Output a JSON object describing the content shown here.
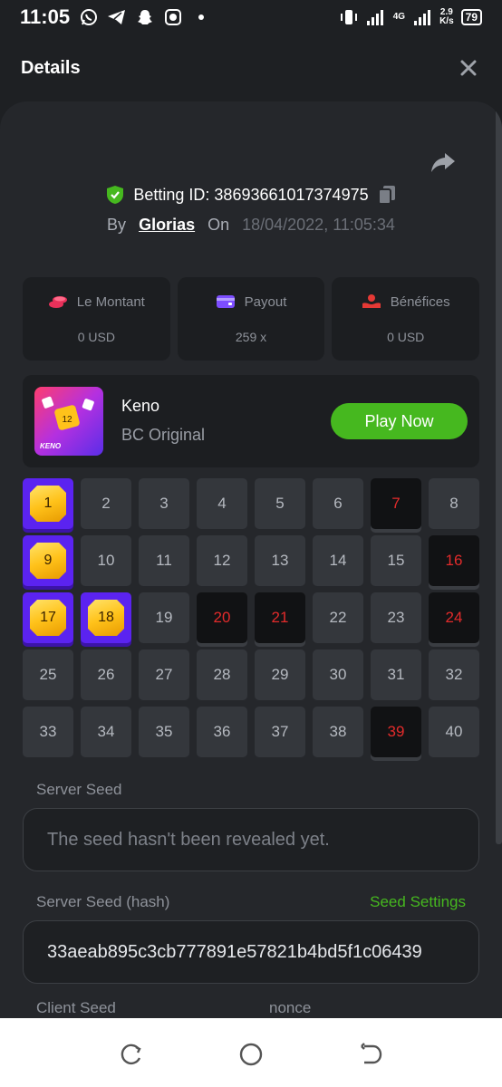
{
  "status_bar": {
    "time": "11:05",
    "network_type": "4G",
    "speed_value": "2.9",
    "speed_unit": "K/s",
    "battery": "79",
    "app_icons": [
      "whatsapp-icon",
      "telegram-icon",
      "snapchat-icon",
      "bitcoin-icon",
      "dot-icon"
    ]
  },
  "header": {
    "title": "Details"
  },
  "bet": {
    "id_label": "Betting ID: 38693661017374975",
    "by_label": "By",
    "username": "Glorias",
    "on_label": "On",
    "date": "18/04/2022, 11:05:34"
  },
  "stats": [
    {
      "label": "Le Montant",
      "value": "0 USD",
      "icon": "coins-icon",
      "color": "#e8315a"
    },
    {
      "label": "Payout",
      "value": "259 x",
      "icon": "wallet-icon",
      "color": "#7c4dff"
    },
    {
      "label": "Bénéfices",
      "value": "0 USD",
      "icon": "profit-icon",
      "color": "#e53935"
    }
  ],
  "game": {
    "name": "Keno",
    "subtitle": "BC Original",
    "thumb_label": "KENO",
    "thumb_number": "12",
    "play_label": "Play Now"
  },
  "keno": {
    "numbers": [
      "1",
      "2",
      "3",
      "4",
      "5",
      "6",
      "7",
      "8",
      "9",
      "10",
      "11",
      "12",
      "13",
      "14",
      "15",
      "16",
      "17",
      "18",
      "19",
      "20",
      "21",
      "22",
      "23",
      "24",
      "25",
      "26",
      "27",
      "28",
      "29",
      "30",
      "31",
      "32",
      "33",
      "34",
      "35",
      "36",
      "37",
      "38",
      "39",
      "40"
    ],
    "hits": [
      "1",
      "9",
      "17",
      "18"
    ],
    "drawn_misses": [
      "7",
      "16",
      "20",
      "21",
      "24",
      "39"
    ]
  },
  "seeds": {
    "server_seed_label": "Server Seed",
    "server_seed_placeholder": "The seed hasn't been revealed yet.",
    "server_hash_label": "Server Seed (hash)",
    "seed_settings_label": "Seed Settings",
    "server_hash_value": "33aeab895c3cb777891e57821b4bd5f1c06439",
    "client_seed_label": "Client Seed",
    "nonce_label": "nonce"
  },
  "colors": {
    "accent_green": "#46b81f",
    "hit_purple": "#5b23f0",
    "drawn_red": "#e32b2b"
  }
}
